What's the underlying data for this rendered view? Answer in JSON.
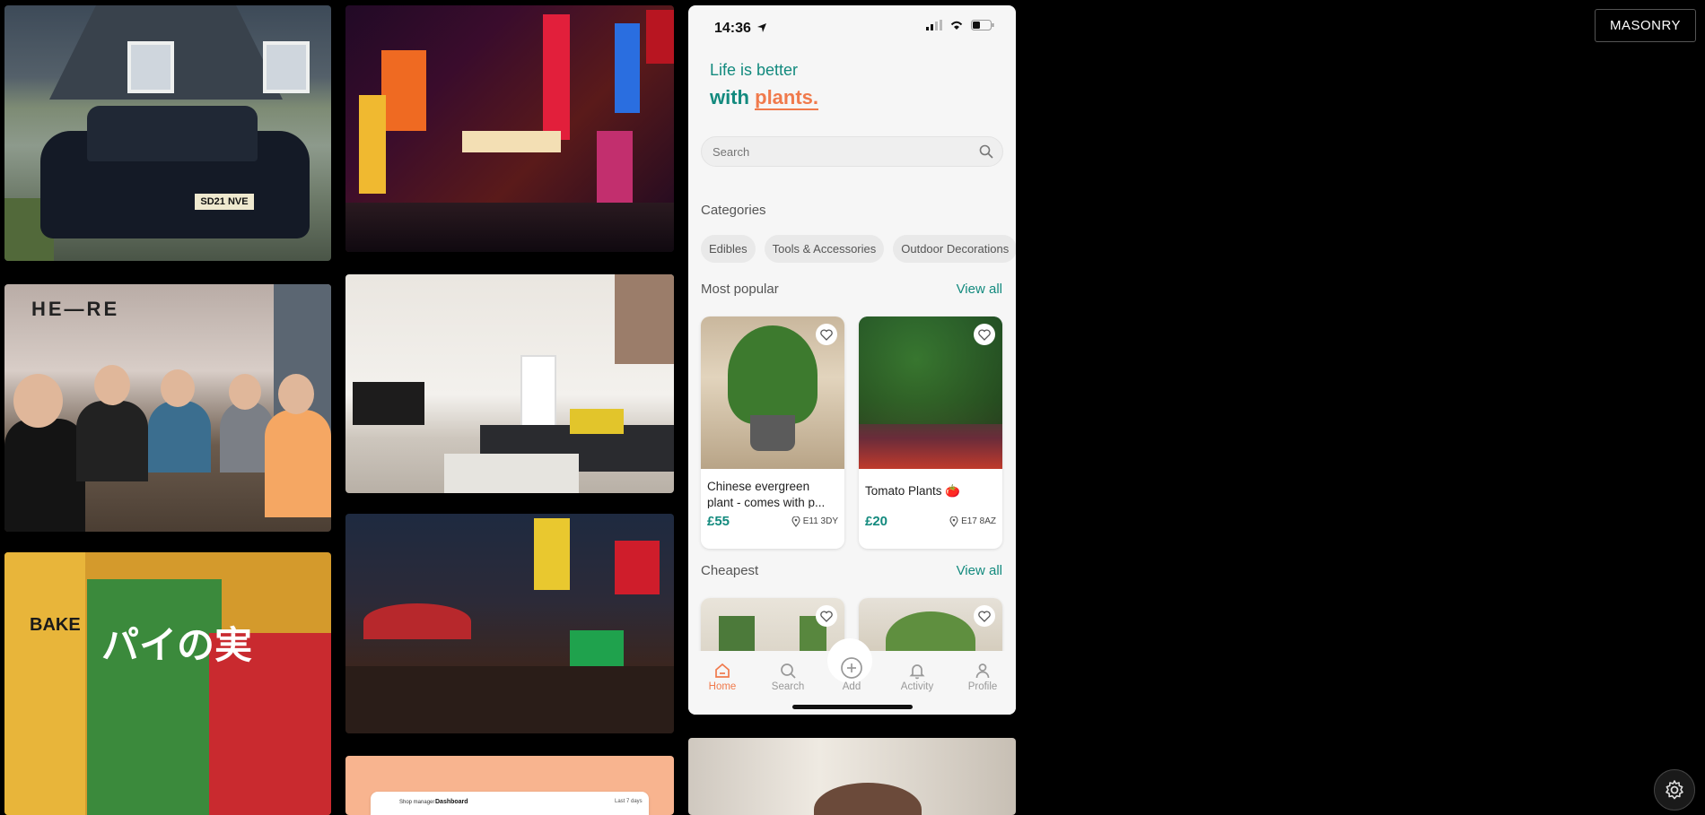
{
  "toolbar": {
    "masonry_label": "MASONRY"
  },
  "gallery": {
    "car_plate": "SD21 NVE",
    "pub_sign": "HE—RE",
    "snack_bake": "BAKE",
    "snack_box_text": "パイの実",
    "dash_brand": "Shop manager",
    "dash_title": "Dashboard",
    "dash_period": "Last 7 days"
  },
  "phone": {
    "status": {
      "time": "14:36"
    },
    "hero": {
      "line1": "Life is better",
      "line2_prefix": "with",
      "line2_accent": "plants."
    },
    "search": {
      "placeholder": "Search"
    },
    "categories": {
      "title": "Categories",
      "items": [
        "Edibles",
        "Tools & Accessories",
        "Outdoor Decorations"
      ]
    },
    "most_popular": {
      "title": "Most popular",
      "view_all": "View all",
      "items": [
        {
          "name": "Chinese evergreen plant - comes with p...",
          "price": "£55",
          "location": "E11 3DY"
        },
        {
          "name": "Tomato Plants 🍅",
          "price": "£20",
          "location": "E17 8AZ"
        }
      ]
    },
    "cheapest": {
      "title": "Cheapest",
      "view_all": "View all"
    },
    "tabs": [
      {
        "label": "Home",
        "icon": "home-icon",
        "active": true
      },
      {
        "label": "Search",
        "icon": "search-icon"
      },
      {
        "label": "Add",
        "icon": "plus-circle-icon"
      },
      {
        "label": "Activity",
        "icon": "bell-icon"
      },
      {
        "label": "Profile",
        "icon": "user-icon"
      }
    ]
  },
  "colors": {
    "accent": "#138a7e",
    "highlight": "#f07a4c",
    "background": "#000000"
  }
}
